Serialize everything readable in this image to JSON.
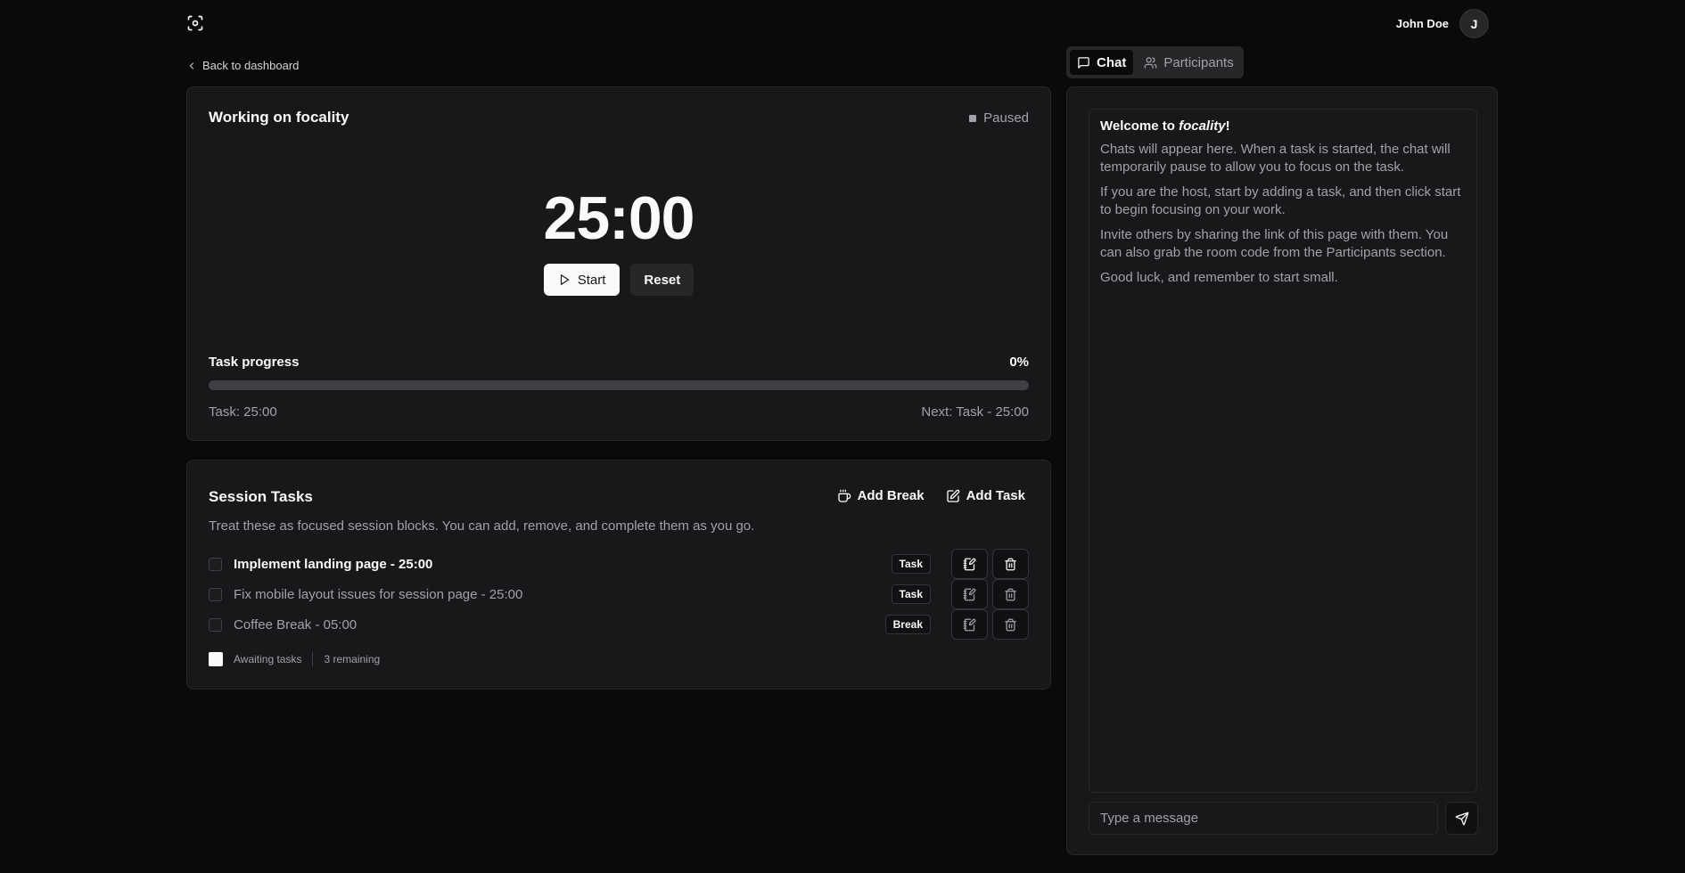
{
  "header": {
    "logo_icon": "focus-scan-icon",
    "user_name": "John Doe",
    "avatar_initial": "J"
  },
  "nav": {
    "back_label": "Back to dashboard"
  },
  "timer": {
    "title": "Working on focality",
    "status": "Paused",
    "time": "25:00",
    "start_label": "Start",
    "reset_label": "Reset",
    "progress_label": "Task progress",
    "progress_value": "0%",
    "progress_fraction": 0,
    "task_time": "Task: 25:00",
    "next_time": "Next: Task - 25:00"
  },
  "session": {
    "title": "Session Tasks",
    "add_break_label": "Add Break",
    "add_task_label": "Add Task",
    "description": "Treat these as focused session blocks. You can add, remove, and complete them as you go.",
    "tasks": [
      {
        "name": "Implement landing page - 25:00",
        "type": "Task",
        "active": true
      },
      {
        "name": "Fix mobile layout issues for session page - 25:00",
        "type": "Task",
        "active": false
      },
      {
        "name": "Coffee Break - 05:00",
        "type": "Break",
        "active": false
      }
    ],
    "footer_status": "Awaiting tasks",
    "footer_remaining": "3 remaining"
  },
  "chat": {
    "tabs": [
      {
        "label": "Chat",
        "icon": "message-square-icon",
        "active": true
      },
      {
        "label": "Participants",
        "icon": "users-icon",
        "active": false
      }
    ],
    "welcome_prefix": "Welcome to ",
    "welcome_app": "focality",
    "welcome_suffix": "!",
    "paragraphs": [
      "Chats will appear here. When a task is started, the chat will temporarily pause to allow you to focus on the task.",
      "If you are the host, start by adding a task, and then click start to begin focusing on your work.",
      "Invite others by sharing the link of this page with them. You can also grab the room code from the Participants section.",
      "Good luck, and remember to start small."
    ],
    "input_placeholder": "Type a message"
  },
  "colors": {
    "background": "#0a0a0b",
    "card": "#18181b",
    "border": "#27272a",
    "text": "#fafafa",
    "muted": "#a1a1aa"
  }
}
